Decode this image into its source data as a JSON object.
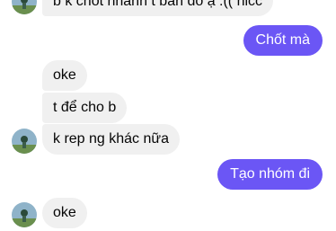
{
  "messages": [
    {
      "id": "m1",
      "sender": "other",
      "text": "b k chốt nhanh t bán đó ạ :(( hicc"
    },
    {
      "id": "m2",
      "sender": "me",
      "text": "Chốt mà"
    },
    {
      "id": "m3",
      "sender": "other",
      "text": "oke"
    },
    {
      "id": "m4",
      "sender": "other",
      "text": "t để cho b"
    },
    {
      "id": "m5",
      "sender": "other",
      "text": "k rep ng khác nữa"
    },
    {
      "id": "m6",
      "sender": "me",
      "text": "Tạo nhóm đi"
    },
    {
      "id": "m7",
      "sender": "other",
      "text": "oke"
    }
  ],
  "theme": {
    "incoming_bubble_color": "#f0f0f0",
    "outgoing_bubble_color": "#6b56f5",
    "incoming_text_color": "#050505",
    "outgoing_text_color": "#ffffff"
  },
  "icons": {
    "avatar": "contact-avatar-photo"
  }
}
